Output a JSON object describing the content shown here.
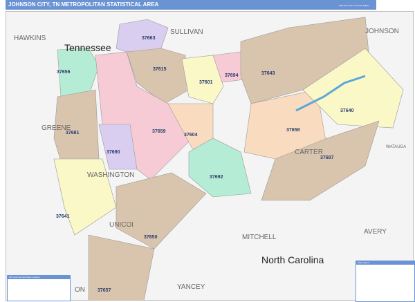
{
  "header": {
    "title": "JOHNSON CITY, TN METROPOLITAN STATISTICAL AREA",
    "edition": "2026 ZIP Code ColorCast Edition"
  },
  "map": {
    "state_labels": [
      "Tennessee",
      "North Carolina"
    ],
    "county_labels": [
      "HAWKINS",
      "SULLIVAN",
      "JOHNSON",
      "GREENE",
      "WASHINGTON",
      "CARTER",
      "UNICOI",
      "MITCHELL",
      "AVERY",
      "YANCEY",
      "WATAUGA",
      "ON"
    ],
    "zip_labels": [
      "37663",
      "37615",
      "37694",
      "37643",
      "37601",
      "37656",
      "37681",
      "37659",
      "37604",
      "37690",
      "37658",
      "37640",
      "37687",
      "37692",
      "37641",
      "37650",
      "37657"
    ]
  },
  "legends": {
    "zip_legend_title": "ZIP Code Number/Cities Location",
    "map_legend_title": "Map Legend"
  },
  "colors": {
    "header": "#6a93d4",
    "tan": "#d9c5ad",
    "pink": "#f7cbd6",
    "green": "#b5ecd5",
    "yellow": "#fbf8c7",
    "lavender": "#d9cdf0",
    "peach": "#f9dcc0"
  }
}
